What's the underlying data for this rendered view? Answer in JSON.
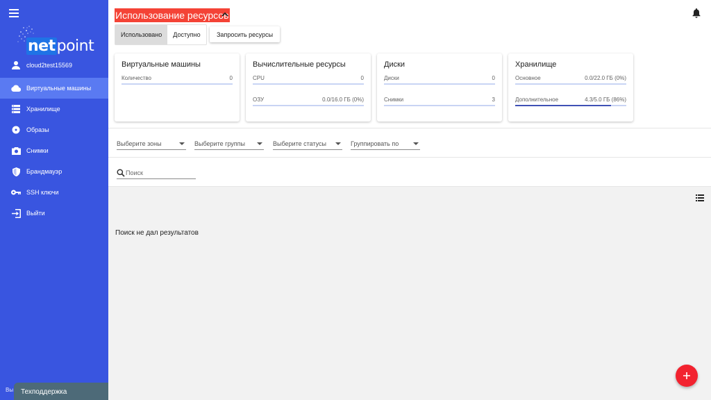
{
  "sidebar": {
    "logo_text_net": "net",
    "logo_text_point": "point",
    "username": "cloud2test15569",
    "items": [
      {
        "label": "Виртуальные машины",
        "icon": "cloud-icon",
        "active": true
      },
      {
        "label": "Хранилище",
        "icon": "storage-icon",
        "active": false
      },
      {
        "label": "Образы",
        "icon": "disc-icon",
        "active": false
      },
      {
        "label": "Снимки",
        "icon": "camera-icon",
        "active": false
      },
      {
        "label": "Брандмауэр",
        "icon": "shield-icon",
        "active": false
      },
      {
        "label": "SSH ключи",
        "icon": "key-icon",
        "active": false
      },
      {
        "label": "Выйти",
        "icon": "exit-icon",
        "active": false
      }
    ],
    "footer_text": "Вы"
  },
  "header": {
    "title": "Использование ресурсов"
  },
  "toggle": {
    "used_label": "Использовано",
    "available_label": "Доступно"
  },
  "request_button_label": "Запросить ресурсы",
  "cards": [
    {
      "title": "Виртуальные машины",
      "metrics": [
        {
          "label": "Количество",
          "value": "0",
          "fill": 0
        }
      ]
    },
    {
      "title": "Вычислительные ресурсы",
      "metrics": [
        {
          "label": "CPU",
          "value": "0",
          "fill": 0
        },
        {
          "label": "ОЗУ",
          "value": "0.0/16.0 ГБ (0%)",
          "fill": 0
        }
      ]
    },
    {
      "title": "Диски",
      "metrics": [
        {
          "label": "Диски",
          "value": "0",
          "fill": 0
        },
        {
          "label": "Снимки",
          "value": "3",
          "fill": 0
        }
      ]
    },
    {
      "title": "Хранилище",
      "metrics": [
        {
          "label": "Основное",
          "value": "0.0/22.0 ГБ (0%)",
          "fill": 0
        },
        {
          "label": "Дополнительное",
          "value": "4.3/5.0 ГБ (86%)",
          "fill": 0.86
        }
      ]
    }
  ],
  "filters": {
    "zones": "Выберите зоны",
    "groups": "Выберите группы",
    "statuses": "Выберите статусы",
    "group_by": "Группировать по"
  },
  "search": {
    "placeholder": "Поиск"
  },
  "empty_message": "Поиск не дал результатов",
  "support_label": "Техподдержка",
  "colors": {
    "sidebar": "#3955e0",
    "sidebar_active": "#5a7af2",
    "title_bg": "#f44336",
    "fab": "#f2222f",
    "bar_fill": "#3f51b5",
    "support": "#4d6a78"
  }
}
